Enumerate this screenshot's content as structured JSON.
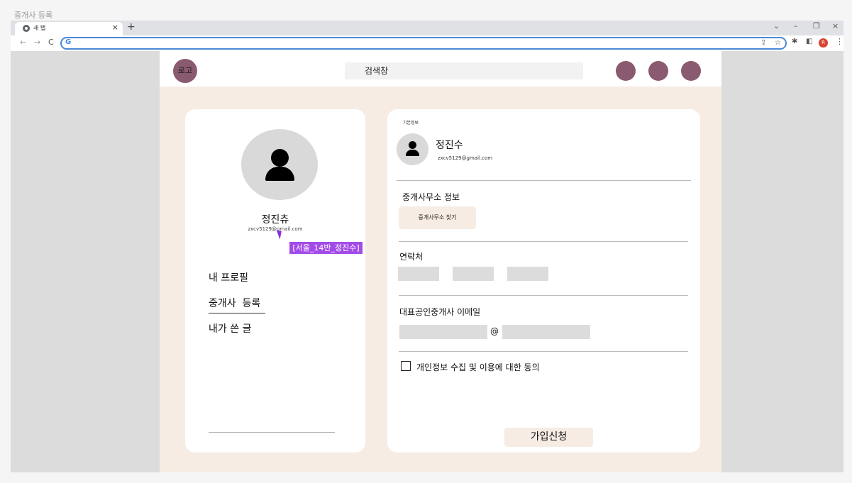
{
  "frame": {
    "title": "중개사 등록"
  },
  "browser": {
    "tab_title": "새 탭",
    "tab_close": "×",
    "new_tab": "+",
    "nav_back": "←",
    "nav_forward": "→",
    "nav_reload": "C",
    "url_icon": "G",
    "url_value": "",
    "profile_initial": "R",
    "win_min": "–",
    "win_max": "❐",
    "win_close": "×",
    "chevron": "⌄"
  },
  "header": {
    "logo": "로고",
    "search_placeholder": "검색창"
  },
  "sidebar": {
    "name": "정진츄",
    "email": "zxcv5129@gmail.com",
    "menu": [
      "내 프로필",
      "중개사  등록",
      "내가 쓴 글"
    ]
  },
  "form": {
    "section_basic": "기본정보",
    "name": "정진수",
    "email": "zxcv5129@gmail.com",
    "office_label": "중개사무소 정보",
    "find_office_button": "중개사무소 찾기",
    "contact_label": "연락처",
    "rep_email_label": "대표공인중개사 이메일",
    "at_symbol": "@",
    "consent_label": "개인정보 수집 및 이용에 대한 동의",
    "submit_button": "가입신청"
  },
  "overlay": {
    "tooltip": "[서울_14반_정진수]"
  },
  "colors": {
    "accent": "#8a5a70",
    "page_bg": "#f7ece3",
    "tooltip": "#a34be8"
  }
}
